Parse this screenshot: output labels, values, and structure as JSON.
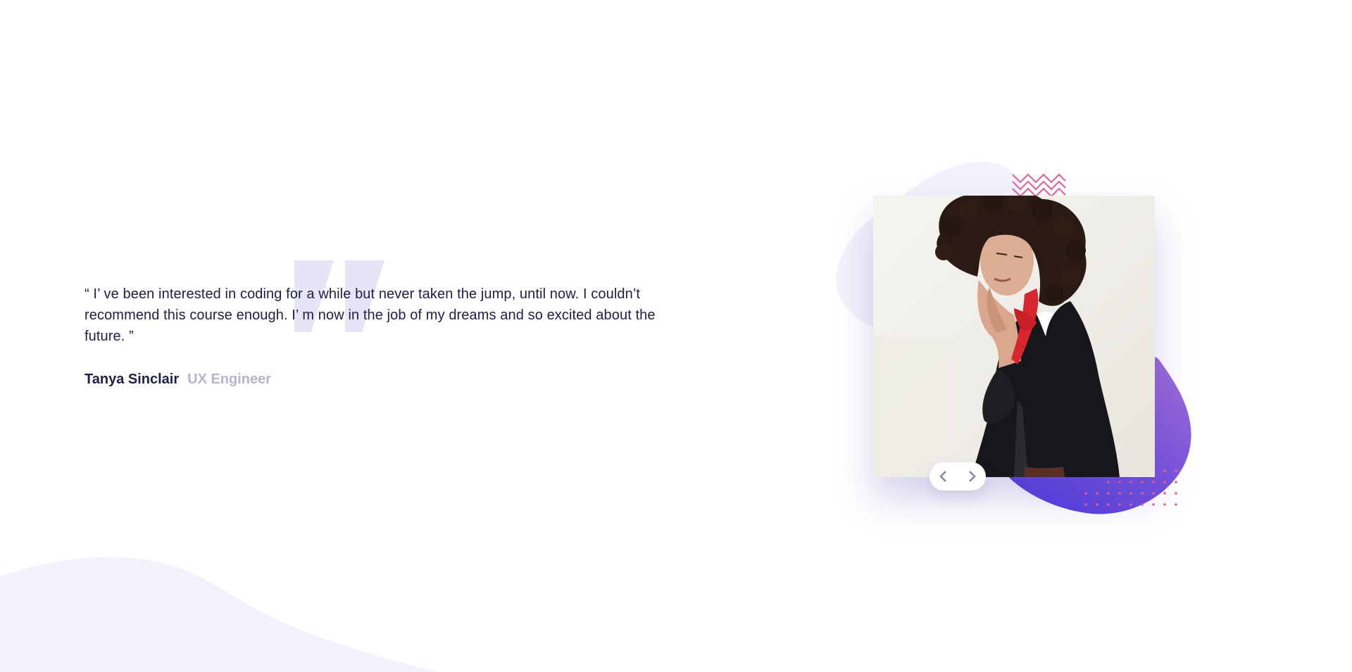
{
  "testimonial": {
    "quote": "“ I’ ve been interested in coding for a while but never taken the jump, until now. I couldn’t recommend this course enough. I’ m now in the job of my dreams and so excited about the future. ”",
    "author_name": "Tanya Sinclair",
    "author_role": "UX Engineer"
  },
  "slider": {
    "prev_icon": "chevron-left-icon",
    "next_icon": "chevron-right-icon"
  },
  "colors": {
    "text_dark": "#202047",
    "text_muted": "#b5b4cb",
    "quote_mark": "#e6e4f7",
    "blob_light": "#f2f2fc",
    "gradient_start": "#9f6cd6",
    "gradient_end": "#4f37e0",
    "accent_pink": "#e0679f",
    "chevron": "#8585ac"
  }
}
